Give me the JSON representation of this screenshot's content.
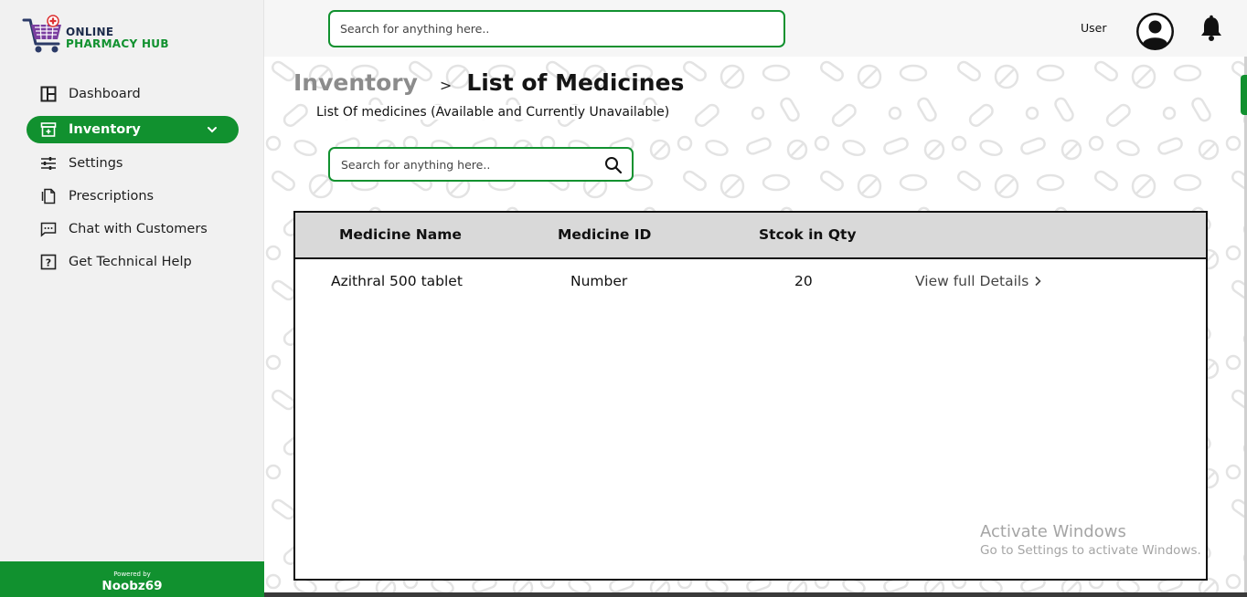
{
  "brand": {
    "line1": "ONLINE",
    "line2": "PHARMACY HUB",
    "powered_small": "Powered by",
    "powered_name": "Noobz69"
  },
  "sidebar": {
    "items": [
      {
        "label": "Dashboard",
        "icon": "dashboard-icon"
      },
      {
        "label": "Inventory",
        "icon": "inventory-box-icon",
        "active": true
      },
      {
        "label": "Settings",
        "icon": "sliders-icon"
      },
      {
        "label": "Prescriptions",
        "icon": "document-icon"
      },
      {
        "label": "Chat with Customers",
        "icon": "chat-icon"
      },
      {
        "label": "Get Technical Help",
        "icon": "help-icon"
      }
    ]
  },
  "topbar": {
    "search_placeholder": "Search for anything here..",
    "user_label": "User"
  },
  "main": {
    "breadcrumb_parent": "Inventory",
    "breadcrumb_separator": ">",
    "breadcrumb_current": "List of Medicines",
    "subtitle": "List Of medicines (Available and Currently Unavailable)",
    "search_placeholder": "Search for anything here.."
  },
  "table": {
    "headers": [
      "Medicine Name",
      "Medicine ID",
      "Stcok in Qty"
    ],
    "rows": [
      {
        "name": "Azithral 500 tablet",
        "id": "Number",
        "qty": "20",
        "action": "View full Details"
      }
    ]
  },
  "watermark": {
    "line1": "Activate Windows",
    "line2": "Go to Settings to activate Windows."
  },
  "colors": {
    "accent": "#11912f",
    "sidebar_bg": "#f1f1f1"
  }
}
